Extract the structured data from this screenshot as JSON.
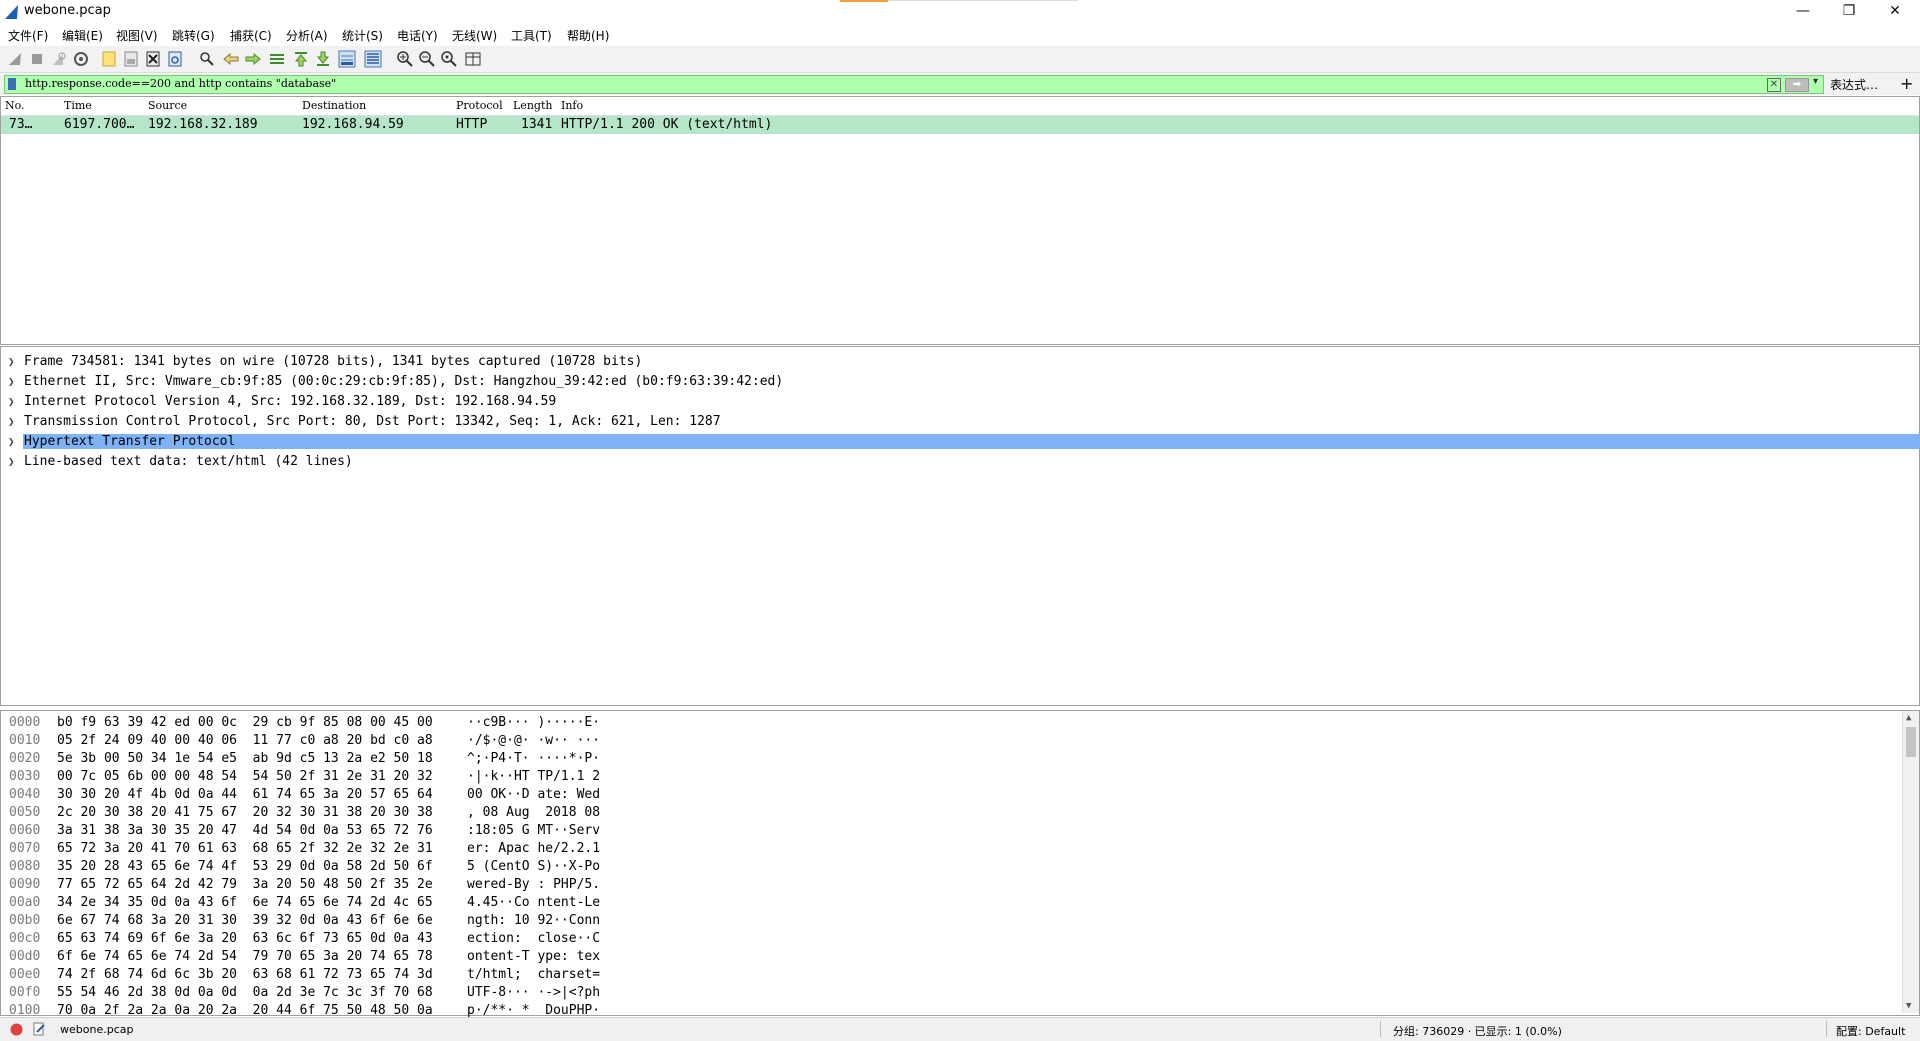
{
  "window": {
    "title": "webone.pcap",
    "controls": {
      "minimize": "—",
      "maximize": "❐",
      "close": "✕"
    }
  },
  "menu": [
    "文件(F)",
    "编辑(E)",
    "视图(V)",
    "跳转(G)",
    "捕获(C)",
    "分析(A)",
    "统计(S)",
    "电话(Y)",
    "无线(W)",
    "工具(T)",
    "帮助(H)"
  ],
  "toolbar": {
    "icons": [
      "start-capture-icon",
      "stop-capture-icon",
      "restart-capture-icon",
      "capture-options-icon",
      "open-file-icon",
      "save-file-icon",
      "close-file-icon",
      "reload-file-icon",
      "find-packet-icon",
      "go-back-icon",
      "go-forward-icon",
      "go-to-packet-icon",
      "go-first-icon",
      "go-last-icon",
      "auto-scroll-icon",
      "colorize-icon",
      "zoom-in-icon",
      "zoom-out-icon",
      "zoom-normal-icon",
      "resize-columns-icon"
    ]
  },
  "filter": {
    "value": "http.response.code==200 and http contains \"database\"",
    "expression_label": "表达式…",
    "add_label": "+"
  },
  "packet_list": {
    "columns": [
      "No.",
      "Time",
      "Source",
      "Destination",
      "Protocol",
      "Length",
      "Info"
    ],
    "rows": [
      {
        "no": "73…",
        "time": "6197.700…",
        "source": "192.168.32.189",
        "destination": "192.168.94.59",
        "protocol": "HTTP",
        "length": "1341",
        "info": "HTTP/1.1 200 OK  (text/html)"
      }
    ]
  },
  "details": [
    "Frame 734581: 1341 bytes on wire (10728 bits), 1341 bytes captured (10728 bits)",
    "Ethernet II, Src: Vmware_cb:9f:85 (00:0c:29:cb:9f:85), Dst: Hangzhou_39:42:ed (b0:f9:63:39:42:ed)",
    "Internet Protocol Version 4, Src: 192.168.32.189, Dst: 192.168.94.59",
    "Transmission Control Protocol, Src Port: 80, Dst Port: 13342, Seq: 1, Ack: 621, Len: 1287",
    "Hypertext Transfer Protocol",
    "Line-based text data: text/html (42 lines)"
  ],
  "bytes": [
    {
      "off": "0000",
      "hex": "b0 f9 63 39 42 ed 00 0c  29 cb 9f 85 08 00 45 00",
      "ascii": "··c9B··· )·····E·"
    },
    {
      "off": "0010",
      "hex": "05 2f 24 09 40 00 40 06  11 77 c0 a8 20 bd c0 a8",
      "ascii": "·/$·@·@· ·w·· ···"
    },
    {
      "off": "0020",
      "hex": "5e 3b 00 50 34 1e 54 e5  ab 9d c5 13 2a e2 50 18",
      "ascii": "^;·P4·T· ····*·P·"
    },
    {
      "off": "0030",
      "hex": "00 7c 05 6b 00 00 48 54  54 50 2f 31 2e 31 20 32",
      "ascii": "·|·k··HT TP/1.1 2"
    },
    {
      "off": "0040",
      "hex": "30 30 20 4f 4b 0d 0a 44  61 74 65 3a 20 57 65 64",
      "ascii": "00 OK··D ate: Wed"
    },
    {
      "off": "0050",
      "hex": "2c 20 30 38 20 41 75 67  20 32 30 31 38 20 30 38",
      "ascii": ", 08 Aug  2018 08"
    },
    {
      "off": "0060",
      "hex": "3a 31 38 3a 30 35 20 47  4d 54 0d 0a 53 65 72 76",
      "ascii": ":18:05 G MT··Serv"
    },
    {
      "off": "0070",
      "hex": "65 72 3a 20 41 70 61 63  68 65 2f 32 2e 32 2e 31",
      "ascii": "er: Apac he/2.2.1"
    },
    {
      "off": "0080",
      "hex": "35 20 28 43 65 6e 74 4f  53 29 0d 0a 58 2d 50 6f",
      "ascii": "5 (CentO S)··X-Po"
    },
    {
      "off": "0090",
      "hex": "77 65 72 65 64 2d 42 79  3a 20 50 48 50 2f 35 2e",
      "ascii": "wered-By : PHP/5."
    },
    {
      "off": "00a0",
      "hex": "34 2e 34 35 0d 0a 43 6f  6e 74 65 6e 74 2d 4c 65",
      "ascii": "4.45··Co ntent-Le"
    },
    {
      "off": "00b0",
      "hex": "6e 67 74 68 3a 20 31 30  39 32 0d 0a 43 6f 6e 6e",
      "ascii": "ngth: 10 92··Conn"
    },
    {
      "off": "00c0",
      "hex": "65 63 74 69 6f 6e 3a 20  63 6c 6f 73 65 0d 0a 43",
      "ascii": "ection:  close··C"
    },
    {
      "off": "00d0",
      "hex": "6f 6e 74 65 6e 74 2d 54  79 70 65 3a 20 74 65 78",
      "ascii": "ontent-T ype: tex"
    },
    {
      "off": "00e0",
      "hex": "74 2f 68 74 6d 6c 3b 20  63 68 61 72 73 65 74 3d",
      "ascii": "t/html;  charset="
    },
    {
      "off": "00f0",
      "hex": "55 54 46 2d 38 0d 0a 0d  0a 2d 3e 7c 3c 3f 70 68",
      "ascii": "UTF-8··· ·->|<?ph"
    },
    {
      "off": "0100",
      "hex": "70 0a 2f 2a 2a 0a 20 2a  20 44 6f 75 50 48 50 0a",
      "ascii": "p·/**· *  DouPHP·"
    }
  ],
  "status": {
    "file": "webone.pcap",
    "packets": "分组: 736029 · 已显示: 1 (0.0%)",
    "profile": "配置: Default"
  },
  "colors": {
    "filter_valid": "#afffaf",
    "row_http": "#b5e6c7",
    "selection": "#7eb2f5"
  }
}
